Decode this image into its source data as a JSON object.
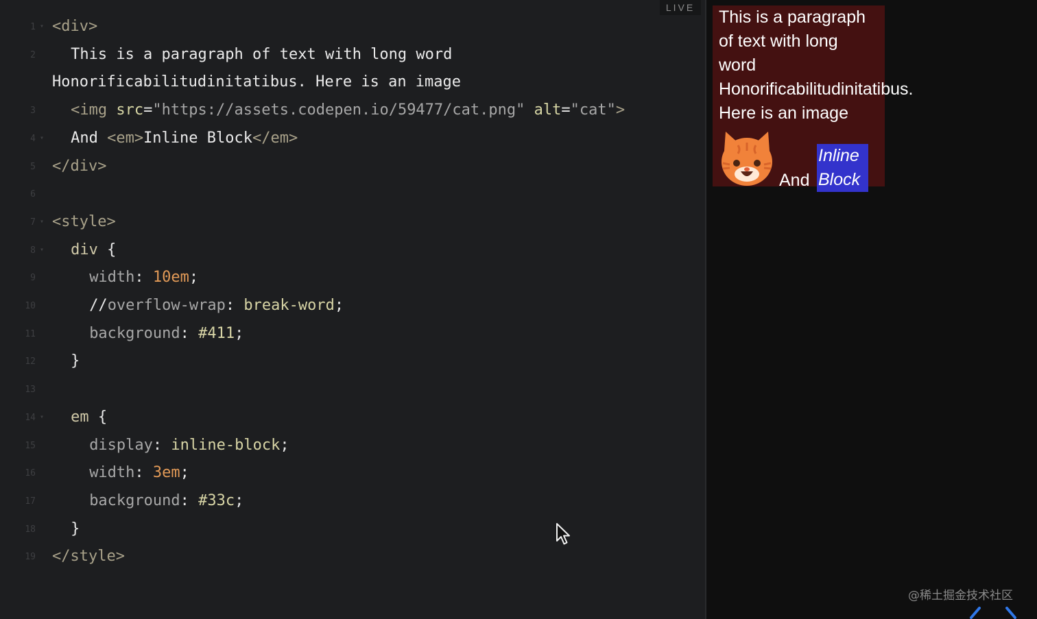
{
  "editor": {
    "live_label": "LIVE",
    "lines": [
      {
        "num": "1",
        "fold": true,
        "indent": 0,
        "tokens": [
          {
            "t": "<div>",
            "c": "tag"
          }
        ]
      },
      {
        "num": "2",
        "fold": false,
        "indent": 2,
        "tokens": [
          {
            "t": "This is a paragraph of text with long word",
            "c": "txt"
          }
        ]
      },
      {
        "num": "",
        "fold": false,
        "indent": 0,
        "tokens": [
          {
            "t": "Honorificabilitudinitatibus. Here is an image",
            "c": "txt"
          }
        ]
      },
      {
        "num": "3",
        "fold": false,
        "indent": 2,
        "tokens": [
          {
            "t": "<img ",
            "c": "tag"
          },
          {
            "t": "src",
            "c": "attr"
          },
          {
            "t": "=",
            "c": "pun"
          },
          {
            "t": "\"https://assets.codepen.io/59477/cat.png\"",
            "c": "str"
          },
          {
            "t": " ",
            "c": "pun"
          },
          {
            "t": "alt",
            "c": "attr"
          },
          {
            "t": "=",
            "c": "pun"
          },
          {
            "t": "\"cat\"",
            "c": "str"
          },
          {
            "t": ">",
            "c": "tag"
          }
        ]
      },
      {
        "num": "4",
        "fold": true,
        "indent": 2,
        "tokens": [
          {
            "t": "And ",
            "c": "txt"
          },
          {
            "t": "<em>",
            "c": "tag"
          },
          {
            "t": "Inline Block",
            "c": "txt"
          },
          {
            "t": "</em>",
            "c": "tag"
          }
        ]
      },
      {
        "num": "5",
        "fold": false,
        "indent": 0,
        "tokens": [
          {
            "t": "</div>",
            "c": "tag"
          }
        ]
      },
      {
        "num": "6",
        "fold": false,
        "indent": 0,
        "tokens": []
      },
      {
        "num": "7",
        "fold": true,
        "indent": 0,
        "tokens": [
          {
            "t": "<style>",
            "c": "tag"
          }
        ]
      },
      {
        "num": "8",
        "fold": true,
        "indent": 2,
        "tokens": [
          {
            "t": "div ",
            "c": "sel"
          },
          {
            "t": "{",
            "c": "pun"
          }
        ]
      },
      {
        "num": "9",
        "fold": false,
        "indent": 4,
        "tokens": [
          {
            "t": "width",
            "c": "prop"
          },
          {
            "t": ": ",
            "c": "pun"
          },
          {
            "t": "10em",
            "c": "num"
          },
          {
            "t": ";",
            "c": "pun"
          }
        ]
      },
      {
        "num": "10",
        "fold": false,
        "indent": 4,
        "tokens": [
          {
            "t": "//",
            "c": "pun"
          },
          {
            "t": "overflow-wrap",
            "c": "prop"
          },
          {
            "t": ": ",
            "c": "pun"
          },
          {
            "t": "break-word",
            "c": "val"
          },
          {
            "t": ";",
            "c": "pun"
          }
        ]
      },
      {
        "num": "11",
        "fold": false,
        "indent": 4,
        "tokens": [
          {
            "t": "background",
            "c": "prop"
          },
          {
            "t": ": ",
            "c": "pun"
          },
          {
            "t": "#411",
            "c": "val"
          },
          {
            "t": ";",
            "c": "pun"
          }
        ]
      },
      {
        "num": "12",
        "fold": false,
        "indent": 2,
        "tokens": [
          {
            "t": "}",
            "c": "pun"
          }
        ]
      },
      {
        "num": "13",
        "fold": false,
        "indent": 0,
        "tokens": []
      },
      {
        "num": "14",
        "fold": true,
        "indent": 2,
        "tokens": [
          {
            "t": "em ",
            "c": "sel"
          },
          {
            "t": "{",
            "c": "pun"
          }
        ]
      },
      {
        "num": "15",
        "fold": false,
        "indent": 4,
        "tokens": [
          {
            "t": "display",
            "c": "prop"
          },
          {
            "t": ": ",
            "c": "pun"
          },
          {
            "t": "inline-block",
            "c": "val"
          },
          {
            "t": ";",
            "c": "pun"
          }
        ]
      },
      {
        "num": "16",
        "fold": false,
        "indent": 4,
        "tokens": [
          {
            "t": "width",
            "c": "prop"
          },
          {
            "t": ": ",
            "c": "pun"
          },
          {
            "t": "3em",
            "c": "num"
          },
          {
            "t": ";",
            "c": "pun"
          }
        ]
      },
      {
        "num": "17",
        "fold": false,
        "indent": 4,
        "tokens": [
          {
            "t": "background",
            "c": "prop"
          },
          {
            "t": ": ",
            "c": "pun"
          },
          {
            "t": "#33c",
            "c": "val"
          },
          {
            "t": ";",
            "c": "pun"
          }
        ]
      },
      {
        "num": "18",
        "fold": false,
        "indent": 2,
        "tokens": [
          {
            "t": "}",
            "c": "pun"
          }
        ]
      },
      {
        "num": "19",
        "fold": false,
        "indent": 0,
        "tokens": [
          {
            "t": "</style>",
            "c": "tag"
          }
        ]
      }
    ]
  },
  "preview": {
    "text_lines": [
      "This is a paragraph",
      "of text with long",
      "word",
      "Honorificabilitudinitatibus.",
      "Here is an image"
    ],
    "image_alt": "cat",
    "and_text": "And",
    "em_lines": [
      "Inline",
      "Block"
    ],
    "div_background": "#441111",
    "em_background": "#3333cc"
  },
  "watermark": "@稀土掘金技术社区",
  "icons": {
    "cursor": "mouse-pointer-icon",
    "cat": "cat-face-icon",
    "prev": "chevron-left-icon",
    "next": "chevron-right-icon"
  }
}
